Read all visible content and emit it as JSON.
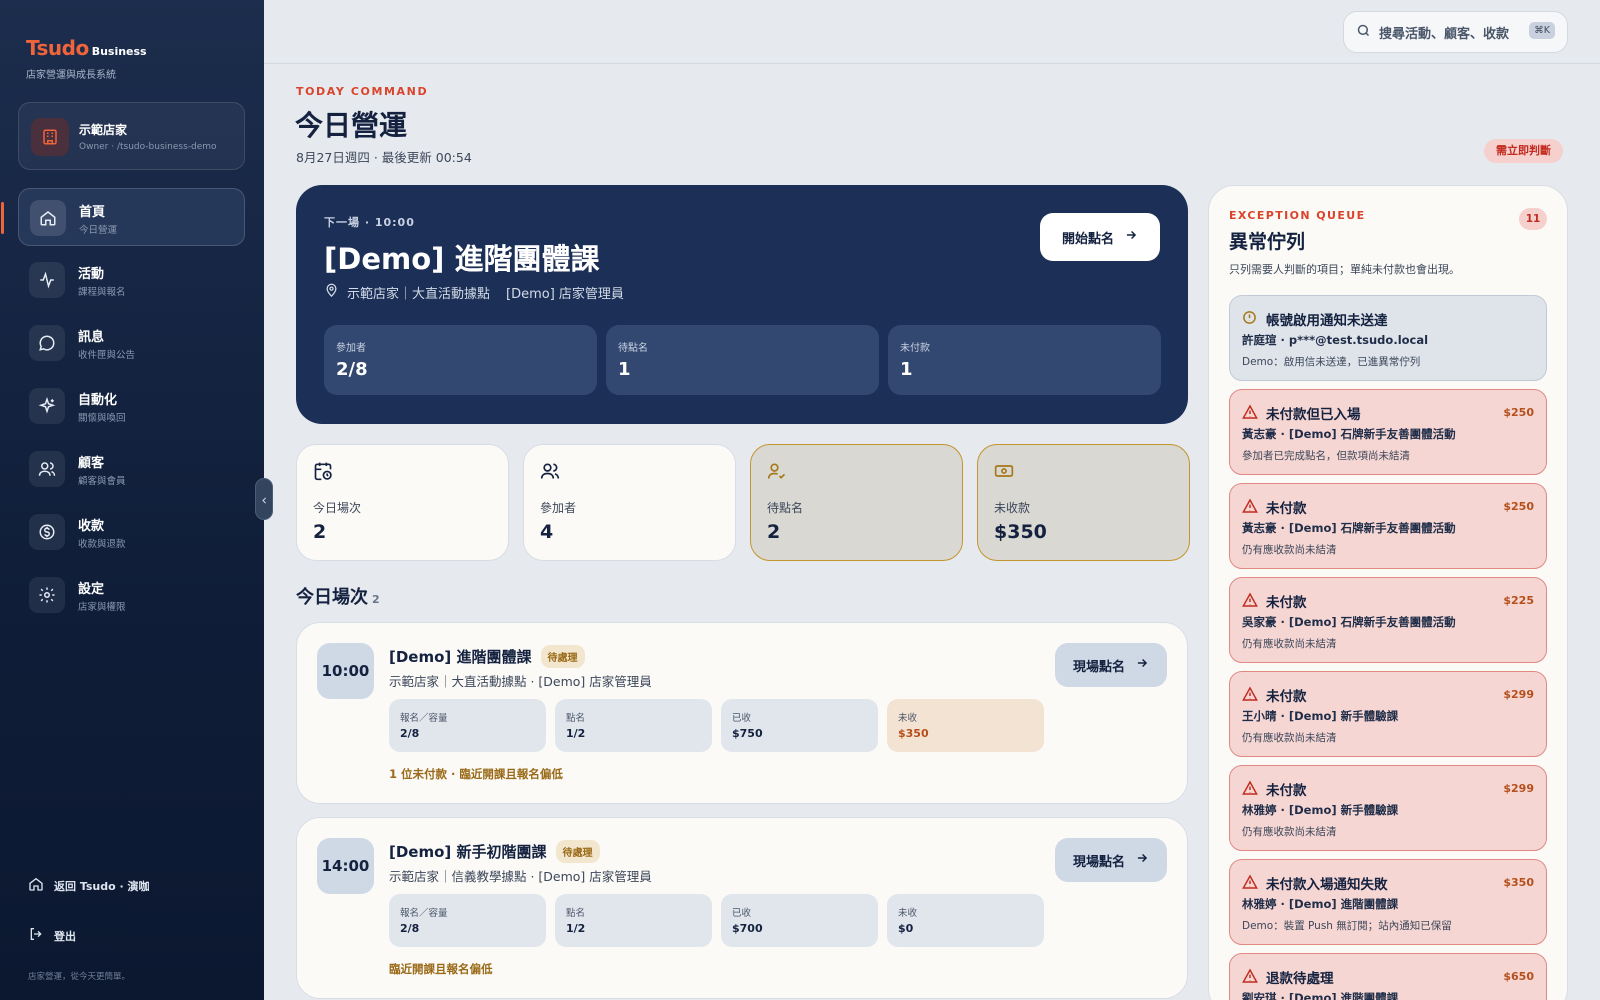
{
  "brand": {
    "name": "Tsudo",
    "suffix": "Business",
    "tagline": "店家營運與成長系統"
  },
  "store": {
    "name": "示範店家",
    "sub": "Owner · /tsudo-business-demo"
  },
  "nav": [
    {
      "label": "首頁",
      "sub": "今日營運",
      "icon": "home-icon",
      "active": true
    },
    {
      "label": "活動",
      "sub": "課程與報名",
      "icon": "activity-icon"
    },
    {
      "label": "訊息",
      "sub": "收件匣與公告",
      "icon": "message-icon"
    },
    {
      "label": "自動化",
      "sub": "關懷與喚回",
      "icon": "sparkle-icon"
    },
    {
      "label": "顧客",
      "sub": "顧客與會員",
      "icon": "users-icon"
    },
    {
      "label": "收款",
      "sub": "收款與退款",
      "icon": "dollar-icon"
    },
    {
      "label": "設定",
      "sub": "店家與權限",
      "icon": "gear-icon"
    }
  ],
  "footer": {
    "back_label": "返回 Tsudo · 演咖",
    "logout_label": "登出",
    "copyright": "店家營運，從今天更簡單。"
  },
  "search": {
    "placeholder": "搜尋活動、顧客、收款",
    "shortcut": "⌘K"
  },
  "header": {
    "eyebrow": "TODAY COMMAND",
    "title": "今日營運",
    "meta": "8月27日週四 · 最後更新 00:54",
    "urgent": "需立即判斷"
  },
  "hero": {
    "eyebrow": "下一場 · 10:00",
    "title": "[Demo] 進階團體課",
    "location": "示範店家｜大直活動據點",
    "staff": "[Demo] 店家管理員",
    "button": "開始點名",
    "stats": [
      {
        "label": "參加者",
        "value": "2/8"
      },
      {
        "label": "待點名",
        "value": "1"
      },
      {
        "label": "未付款",
        "value": "1"
      }
    ]
  },
  "kpis": [
    {
      "label": "今日場次",
      "value": "2",
      "icon": "calendar-clock-icon",
      "warn": false
    },
    {
      "label": "參加者",
      "value": "4",
      "icon": "users-icon",
      "warn": false
    },
    {
      "label": "待點名",
      "value": "2",
      "icon": "user-check-icon",
      "warn": true
    },
    {
      "label": "未收款",
      "value": "$350",
      "icon": "banknote-icon",
      "warn": true
    }
  ],
  "sessions_section": {
    "title": "今日場次",
    "count": "2"
  },
  "sessions": [
    {
      "time": "10:00",
      "title": "[Demo] 進階團體課",
      "status": "待處理",
      "sub": "示範店家｜大直活動據點 · [Demo] 店家管理員",
      "button": "現場點名",
      "stats": [
        {
          "label": "報名／容量",
          "value": "2/8"
        },
        {
          "label": "點名",
          "value": "1/2"
        },
        {
          "label": "已收",
          "value": "$750"
        },
        {
          "label": "未收",
          "value": "$350",
          "alert": true
        }
      ],
      "note": "1 位未付款 · 臨近開課且報名偏低"
    },
    {
      "time": "14:00",
      "title": "[Demo] 新手初階團課",
      "status": "待處理",
      "sub": "示範店家｜信義教學據點 · [Demo] 店家管理員",
      "button": "現場點名",
      "stats": [
        {
          "label": "報名／容量",
          "value": "2/8"
        },
        {
          "label": "點名",
          "value": "1/2"
        },
        {
          "label": "已收",
          "value": "$700"
        },
        {
          "label": "未收",
          "value": "$0"
        }
      ],
      "note": "臨近開課且報名偏低"
    }
  ],
  "queue": {
    "eyebrow": "EXCEPTION QUEUE",
    "count": "11",
    "title": "異常佇列",
    "desc": "只列需要人判斷的項目；單純未付款也會出現。",
    "items": [
      {
        "type": "info",
        "title": "帳號啟用通知未送達",
        "amount": "",
        "who": "許庭瑄 · p***@test.tsudo.local",
        "note": "Demo：啟用信未送達，已進異常佇列"
      },
      {
        "type": "alert",
        "title": "未付款但已入場",
        "amount": "$250",
        "who": "黃志豪 · [Demo] 石牌新手友善團體活動",
        "note": "參加者已完成點名，但款項尚未結清"
      },
      {
        "type": "alert",
        "title": "未付款",
        "amount": "$250",
        "who": "黃志豪 · [Demo] 石牌新手友善團體活動",
        "note": "仍有應收款尚未結清"
      },
      {
        "type": "alert",
        "title": "未付款",
        "amount": "$225",
        "who": "吳家豪 · [Demo] 石牌新手友善團體活動",
        "note": "仍有應收款尚未結清"
      },
      {
        "type": "alert",
        "title": "未付款",
        "amount": "$299",
        "who": "王小晴 · [Demo] 新手體驗課",
        "note": "仍有應收款尚未結清"
      },
      {
        "type": "alert",
        "title": "未付款",
        "amount": "$299",
        "who": "林雅婷 · [Demo] 新手體驗課",
        "note": "仍有應收款尚未結清"
      },
      {
        "type": "alert",
        "title": "未付款入場通知失敗",
        "amount": "$350",
        "who": "林雅婷 · [Demo] 進階團體課",
        "note": "Demo：裝置 Push 無訂閱；站內通知已保留"
      },
      {
        "type": "alert",
        "title": "退款待處理",
        "amount": "$650",
        "who": "劉安琪 · [Demo] 進階團體課",
        "note": ""
      }
    ]
  },
  "colors": {
    "accent": "#f0643c",
    "navy": "#1c2f56",
    "danger": "#d9442b",
    "warn": "#c2952e"
  }
}
